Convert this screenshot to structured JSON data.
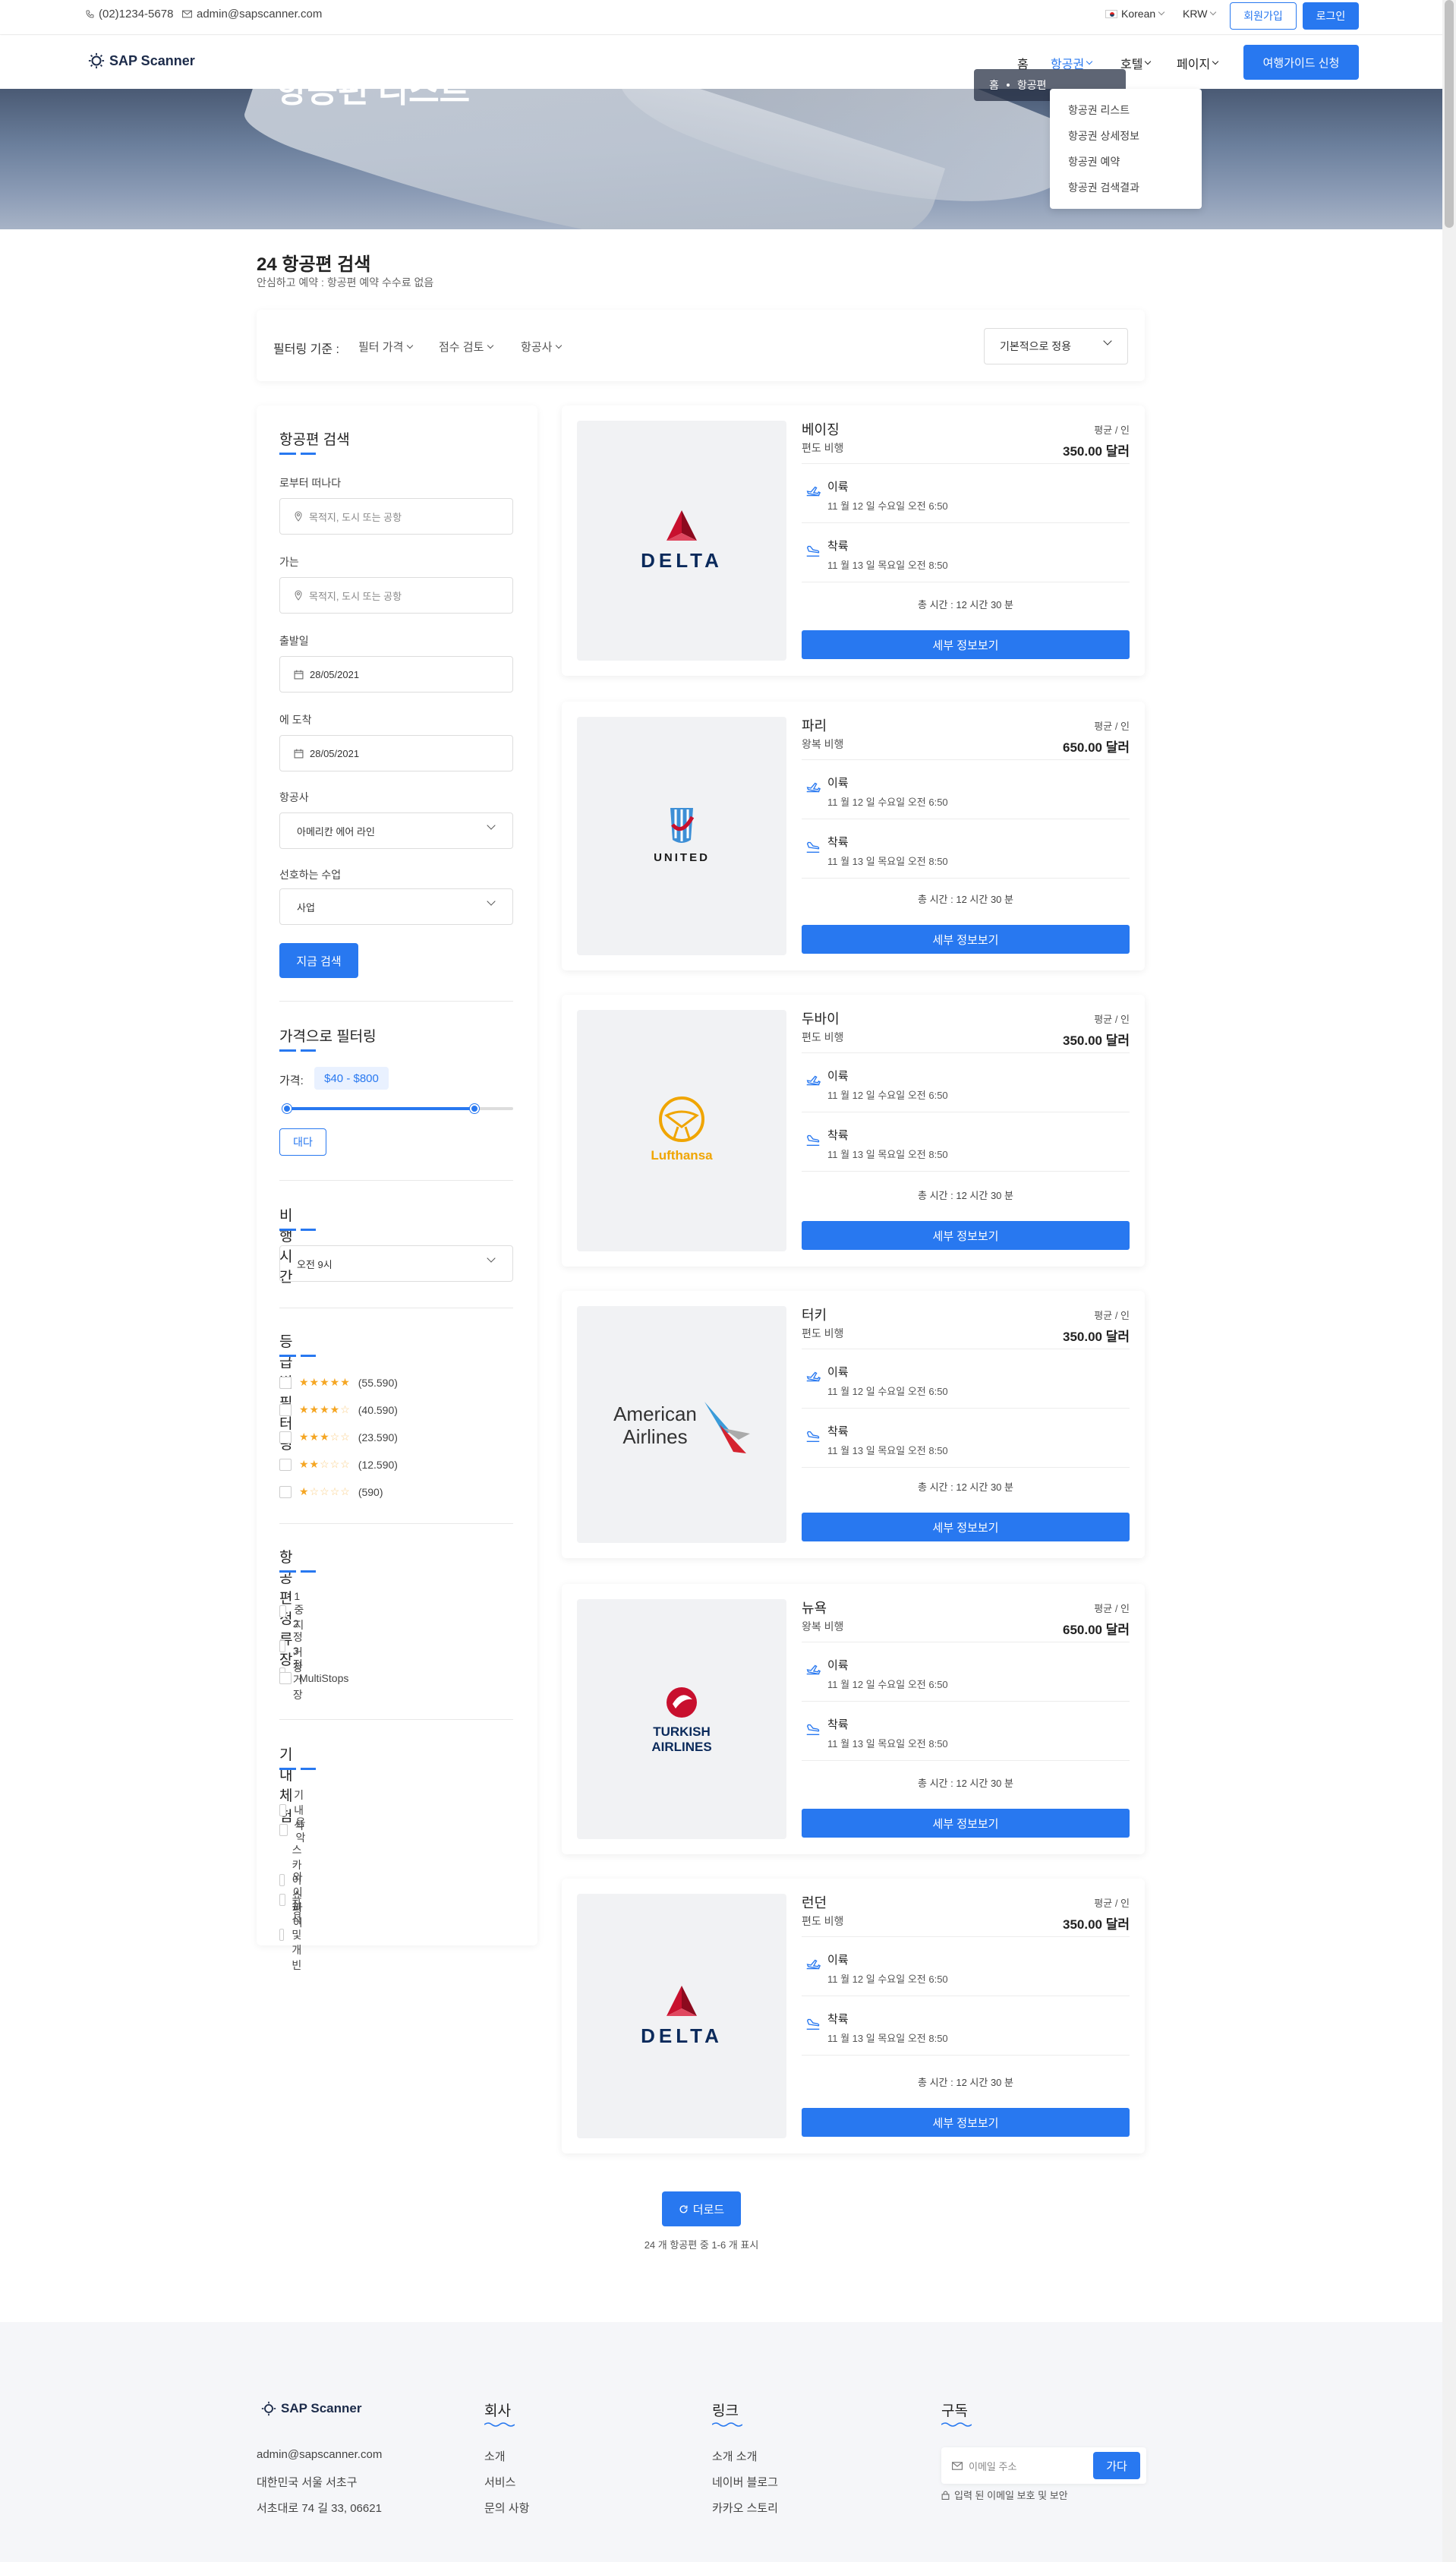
{
  "topbar": {
    "phone": "(02)1234-5678",
    "email": "admin@sapscanner.com",
    "language": "Korean",
    "currency": "KRW",
    "signup": "회원가입",
    "login": "로그인"
  },
  "nav": {
    "brand": "SAP Scanner",
    "items": [
      "홈",
      "항공권",
      "호텔",
      "페이지"
    ],
    "cta": "여행가이드 신청",
    "dropdown": [
      "항공권 리스트",
      "항공권 상세정보",
      "항공권 예약",
      "항공권 검색결과"
    ]
  },
  "hero": {
    "title": "항공편 리스트",
    "breadcrumb": [
      "홈",
      "항공편"
    ]
  },
  "results": {
    "title": "24 항공편 검색",
    "subtitle": "안심하고 예약 : 항공편 예약 수수료 없음",
    "filter_label": "필터링 기준 :",
    "filters": [
      "필터 가격",
      "점수 검토",
      "항공사"
    ],
    "sort": "기본적으로 정용"
  },
  "sidebar": {
    "search_title": "항공편 검색",
    "from_label": "로부터 떠나다",
    "from_placeholder": "목적지, 도시 또는 공항",
    "to_label": "가는",
    "to_placeholder": "목적지, 도시 또는 공항",
    "depart_label": "출발일",
    "depart_value": "28/05/2021",
    "arrive_label": "에 도착",
    "arrive_value": "28/05/2021",
    "airline_label": "항공사",
    "airline_value": "아메리칸 에어 라인",
    "class_label": "선호하는 수업",
    "class_value": "사업",
    "search_btn": "지금 검색",
    "price_title": "가격으로 필터링",
    "price_label": "가격:",
    "price_range": "$40 - $800",
    "price_range_fraction": [
      0.0,
      0.83
    ],
    "price_btn": "대다",
    "time_title": "비행 시간",
    "time_value": "오전 9시",
    "rating_title": "등급별 필터링",
    "ratings": [
      {
        "stars": 5,
        "count": "(55.590)"
      },
      {
        "stars": 4,
        "count": "(40.590)"
      },
      {
        "stars": 3,
        "count": "(23.590)"
      },
      {
        "stars": 2,
        "count": "(12.590)"
      },
      {
        "stars": 1,
        "count": "(590)"
      }
    ],
    "stops_title": "항공편 정류장",
    "stops": [
      "1 중지",
      "2 정거장",
      "3 정거장",
      "MultiStops"
    ],
    "inflight_title": "기내 체험",
    "inflight": [
      "기내식",
      "음악",
      "스카이 쇼핑",
      "와이파이",
      "좌석 및 개빈"
    ]
  },
  "flights": [
    {
      "city": "베이징",
      "type": "편도 비행",
      "per": "평균 / 인",
      "price": "350.00 달러",
      "airline": "DELTA",
      "dep_t": "이륙",
      "dep_d": "11 월 12 일 수요일 오전 6:50",
      "arr_t": "착륙",
      "arr_d": "11 월 13 일 목요일 오전 8:50",
      "total": "총 시간 : 12 시간 30 분",
      "btn": "세부 정보보기"
    },
    {
      "city": "파리",
      "type": "왕복 비행",
      "per": "평균 / 인",
      "price": "650.00 달러",
      "airline": "UNITED",
      "dep_t": "이륙",
      "dep_d": "11 월 12 일 수요일 오전 6:50",
      "arr_t": "착륙",
      "arr_d": "11 월 13 일 목요일 오전 8:50",
      "total": "총 시간 : 12 시간 30 분",
      "btn": "세부 정보보기"
    },
    {
      "city": "두바이",
      "type": "편도 비행",
      "per": "평균 / 인",
      "price": "350.00 달러",
      "airline": "Lufthansa",
      "dep_t": "이륙",
      "dep_d": "11 월 12 일 수요일 오전 6:50",
      "arr_t": "착륙",
      "arr_d": "11 월 13 일 목요일 오전 8:50",
      "total": "총 시간 : 12 시간 30 분",
      "btn": "세부 정보보기"
    },
    {
      "city": "터키",
      "type": "편도 비행",
      "per": "평균 / 인",
      "price": "350.00 달러",
      "airline": "American Airlines",
      "dep_t": "이륙",
      "dep_d": "11 월 12 일 수요일 오전 6:50",
      "arr_t": "착륙",
      "arr_d": "11 월 13 일 목요일 오전 8:50",
      "total": "총 시간 : 12 시간 30 분",
      "btn": "세부 정보보기"
    },
    {
      "city": "뉴욕",
      "type": "왕복 비행",
      "per": "평균 / 인",
      "price": "650.00 달러",
      "airline": "TURKISH AIRLINES",
      "dep_t": "이륙",
      "dep_d": "11 월 12 일 수요일 오전 6:50",
      "arr_t": "착륙",
      "arr_d": "11 월 13 일 목요일 오전 8:50",
      "total": "총 시간 : 12 시간 30 분",
      "btn": "세부 정보보기"
    },
    {
      "city": "런던",
      "type": "편도 비행",
      "per": "평균 / 인",
      "price": "350.00 달러",
      "airline": "DELTA",
      "dep_t": "이륙",
      "dep_d": "11 월 12 일 수요일 오전 6:50",
      "arr_t": "착륙",
      "arr_d": "11 월 13 일 목요일 오전 8:50",
      "total": "총 시간 : 12 시간 30 분",
      "btn": "세부 정보보기"
    }
  ],
  "load_more": {
    "label": "더로드",
    "note": "24 개 항공편 중 1-6 개 표시"
  },
  "footer": {
    "brand": "SAP Scanner",
    "email": "admin@sapscanner.com",
    "address1": "대한민국 서울 서초구",
    "address2": "서초대로 74 길 33, 06621",
    "company_title": "회사",
    "company_links": [
      "소개",
      "서비스",
      "문의 사항"
    ],
    "links_title": "링크",
    "links": [
      "소개 소개",
      "네이버 블로그",
      "카카오 스토리"
    ],
    "subscribe_title": "구독",
    "subscribe_placeholder": "이메일 주소",
    "subscribe_btn": "가다",
    "subscribe_note": "입력 된 이메일 보호 및 보안"
  },
  "colors": {
    "accent": "#2878f0",
    "star": "#f5a623",
    "delta_red": "#c8102e",
    "delta_navy": "#0b2a5b",
    "lufthansa_yellow": "#f0a500",
    "aa_red": "#d5232f",
    "aa_blue": "#3a9bd9",
    "turkish_red": "#c8102e"
  }
}
